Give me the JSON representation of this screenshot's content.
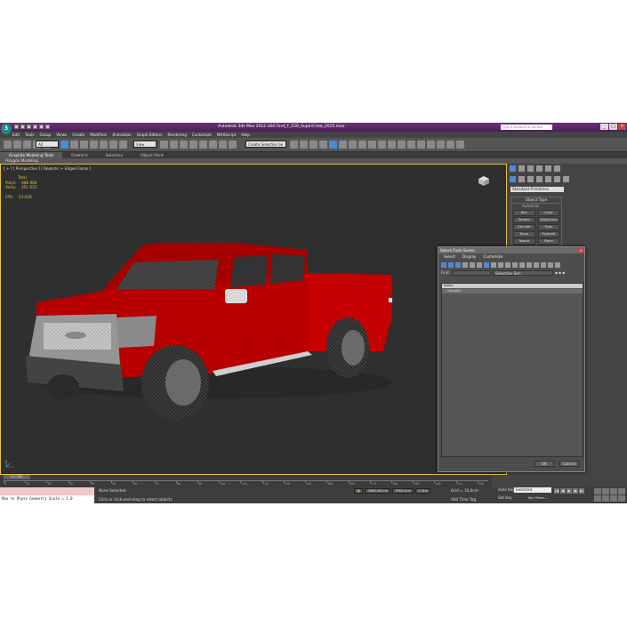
{
  "window": {
    "title": "Autodesk 3ds Max 2012 x64      Ford_F_150_SuperCrew_2015.max",
    "search_placeholder": "Type a keyword or phrase",
    "app_logo": "3",
    "controls": [
      "_",
      "□",
      "×"
    ]
  },
  "menu": [
    "Edit",
    "Tools",
    "Group",
    "Views",
    "Create",
    "Modifiers",
    "Animation",
    "Graph Editors",
    "Rendering",
    "Customize",
    "MAXScript",
    "Help"
  ],
  "toolbar": {
    "selection_filter": "All",
    "ref_coord": "View",
    "named_selection": "Create Selection Se"
  },
  "ribbon": {
    "tabs": [
      "Graphite Modeling Tools",
      "Freeform",
      "Selection",
      "Object Paint"
    ],
    "active_tab": 0,
    "subtitle": "Polygon Modeling"
  },
  "viewport": {
    "label": "[ + ] [ Perspective ] [ Realistic + Edged Faces ]",
    "stats_header": "Total",
    "polys_label": "Polys:",
    "polys_value": "486 906",
    "verts_label": "Verts:",
    "verts_value": "251 622",
    "fps_label": "FPS:",
    "fps_value": "23.029"
  },
  "command_panel": {
    "category": "Standard Primitives",
    "object_type_header": "Object Type",
    "autogrid": "AutoGrid",
    "primitives": [
      "Box",
      "Cone",
      "Sphere",
      "GeoSphere",
      "Cylinder",
      "Tube",
      "Torus",
      "Pyramid",
      "Teapot",
      "Plane"
    ]
  },
  "select_dialog": {
    "title": "Select From Scene",
    "menu": [
      "Select",
      "Display",
      "Customize"
    ],
    "find_label": "Find:",
    "selection_set_label": "Selection Set:",
    "column_header": "Name",
    "items": [
      "Group01"
    ],
    "ok": "OK",
    "cancel": "Cancel"
  },
  "timeline": {
    "slider": "0 / 225",
    "ticks": [
      "0",
      "10",
      "20",
      "30",
      "40",
      "50",
      "60",
      "70",
      "80",
      "90",
      "100",
      "110",
      "120",
      "130",
      "140",
      "150",
      "160",
      "170",
      "180",
      "190",
      "200",
      "210",
      "220"
    ]
  },
  "status": {
    "maxscript_output": "",
    "maxscript_input": "Max to Physx Geometry Scale = 1.0",
    "selection_status": "None Selected",
    "prompt": "Click or click-and-drag to select objects",
    "x": "1886.261cm",
    "y": "1963.4cm",
    "z": "0.0cm",
    "grid": "Grid = 10,0cm",
    "add_time_tag": "Add Time Tag",
    "auto_key": "Auto Key",
    "selected": "Selected",
    "set_key": "Set Key",
    "key_filters": "Key Filters...",
    "frame": "0"
  },
  "colors": {
    "title_bar": "#5d2a6a",
    "viewport_bg": "#2f2f2f",
    "truck_body": "#c40000",
    "stats_text": "#e6c43a",
    "viewport_border": "#e3c34a",
    "maxscript_bg": "#f4c7cf"
  }
}
